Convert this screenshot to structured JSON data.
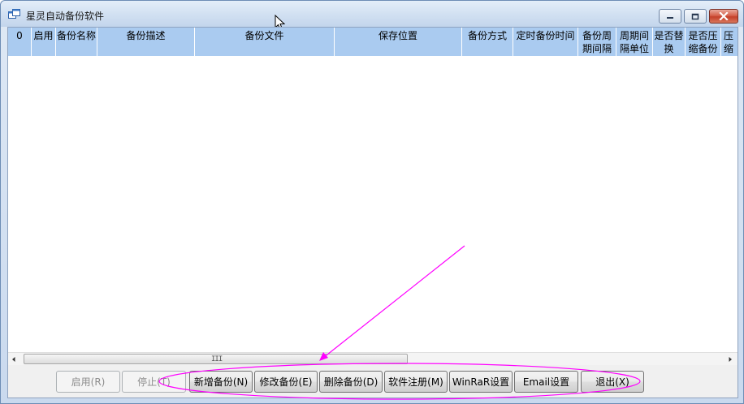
{
  "window": {
    "title": "星灵自动备份软件"
  },
  "grid": {
    "columns": [
      "0",
      "启用",
      "备份名称",
      "备份描述",
      "备份文件",
      "保存位置",
      "备份方式",
      "定时备份时间",
      "备份周\n期间隔",
      "周期间\n隔单位",
      "是否替\n换",
      "是否压\n缩备份",
      "压缩"
    ],
    "rows": [],
    "scroll_grip": "III"
  },
  "toolbar": {
    "enable_label": "启用(R)",
    "stop_label": "停止(T)",
    "add_label": "新增备份(N)",
    "edit_label": "修改备份(E)",
    "delete_label": "删除备份(D)",
    "register_label": "软件注册(M)",
    "winrar_label": "WinRaR设置",
    "email_label": "Email设置",
    "exit_label": "退出(X)"
  },
  "icons": {
    "app": "app-window-icon",
    "minimize": "minimize-icon",
    "maximize": "maximize-icon",
    "close": "close-icon",
    "cursor": "mouse-cursor-icon",
    "scroll_left": "scroll-left-arrow-icon",
    "scroll_right": "scroll-right-arrow-icon"
  },
  "colors": {
    "header_bg": "#aacbf0",
    "annotation": "#ff00ff",
    "close_button": "#c4402a"
  }
}
